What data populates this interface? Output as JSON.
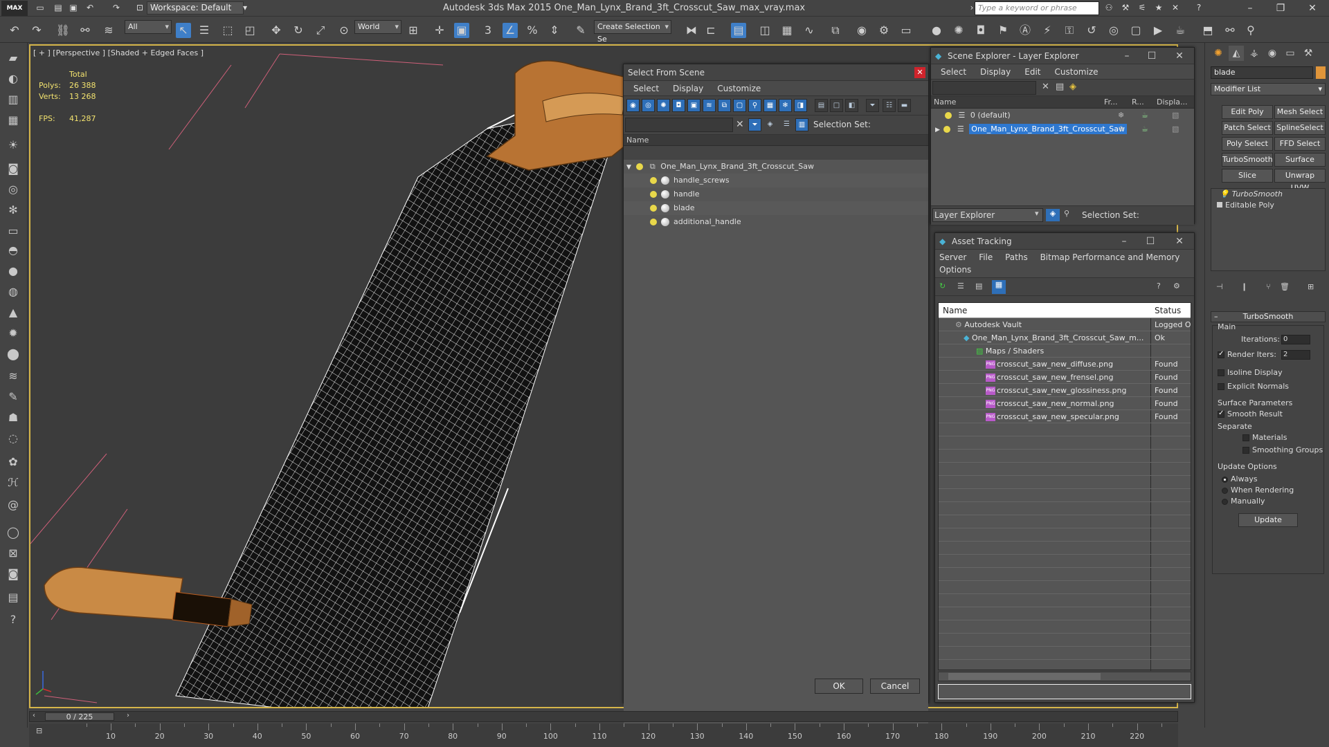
{
  "titlebar": {
    "logo": "MAX",
    "workspace": "Workspace: Default",
    "app_title": "Autodesk 3ds Max  2015      One_Man_Lynx_Brand_3ft_Crosscut_Saw_max_vray.max",
    "search_placeholder": "Type a keyword or phrase"
  },
  "toolbar": {
    "filter_select": "All",
    "coord_select": "World",
    "selection_set_placeholder": "Create Selection Se"
  },
  "viewport": {
    "label": "[ + ] [Perspective ] [Shaded + Edged Faces ]",
    "stats": {
      "header": "Total",
      "polys_label": "Polys:",
      "polys_value": "26 388",
      "verts_label": "Verts:",
      "verts_value": "13 268",
      "fps_label": "FPS:",
      "fps_value": "41,287"
    }
  },
  "select_from_scene": {
    "title": "Select From Scene",
    "menu": [
      "Select",
      "Display",
      "Customize"
    ],
    "selection_set_label": "Selection Set:",
    "column_name": "Name",
    "root": "One_Man_Lynx_Brand_3ft_Crosscut_Saw",
    "children": [
      "handle_screws",
      "handle",
      "blade",
      "additional_handle"
    ],
    "ok_label": "OK",
    "cancel_label": "Cancel"
  },
  "scene_explorer": {
    "title": "Scene Explorer - Layer Explorer",
    "menu": [
      "Select",
      "Display",
      "Edit",
      "Customize"
    ],
    "columns": [
      "Name",
      "Fr...",
      "R...",
      "Displa..."
    ],
    "rows": [
      "0 (default)",
      "One_Man_Lynx_Brand_3ft_Crosscut_Saw"
    ],
    "explorer_select": "Layer Explorer",
    "selection_set_label": "Selection Set:"
  },
  "asset_tracking": {
    "title": "Asset Tracking",
    "menu_row1": [
      "Server",
      "File",
      "Paths",
      "Bitmap Performance and Memory"
    ],
    "menu_row2": [
      "Options"
    ],
    "col_name": "Name",
    "col_status": "Status",
    "rows": [
      {
        "name": "Autodesk Vault",
        "status": "Logged O"
      },
      {
        "name": "One_Man_Lynx_Brand_3ft_Crosscut_Saw_m...",
        "status": "Ok"
      },
      {
        "name": "Maps / Shaders",
        "status": ""
      },
      {
        "name": "crosscut_saw_new_diffuse.png",
        "status": "Found"
      },
      {
        "name": "crosscut_saw_new_frensel.png",
        "status": "Found"
      },
      {
        "name": "crosscut_saw_new_glossiness.png",
        "status": "Found"
      },
      {
        "name": "crosscut_saw_new_normal.png",
        "status": "Found"
      },
      {
        "name": "crosscut_saw_new_specular.png",
        "status": "Found"
      }
    ],
    "png_badge": "PNG"
  },
  "command_panel": {
    "object_name": "blade",
    "modifier_list": "Modifier List",
    "mod_buttons": [
      "Edit Poly",
      "Mesh Select",
      "Patch Select",
      "SplineSelect",
      "Poly Select",
      "FFD Select",
      "TurboSmooth",
      "Surface Select",
      "Slice",
      "Unwrap UVW"
    ],
    "stack": [
      "TurboSmooth",
      "Editable Poly"
    ],
    "rollout_title": "TurboSmooth",
    "main_label": "Main",
    "iterations_label": "Iterations:",
    "iterations_value": "0",
    "render_iters_label": "Render Iters:",
    "render_iters_value": "2",
    "isoline_label": "Isoline Display",
    "explicit_normals_label": "Explicit Normals",
    "surface_params_label": "Surface Parameters",
    "smooth_result_label": "Smooth Result",
    "separate_label": "Separate",
    "materials_label": "Materials",
    "smoothing_groups_label": "Smoothing Groups",
    "update_options_label": "Update Options",
    "always_label": "Always",
    "when_rendering_label": "When Rendering",
    "manually_label": "Manually",
    "update_button": "Update"
  },
  "timeline": {
    "frame_display": "0 / 225",
    "ticks": [
      "10",
      "20",
      "30",
      "40",
      "50",
      "60",
      "70",
      "80",
      "90",
      "100",
      "110",
      "120",
      "130",
      "140",
      "150",
      "160",
      "170",
      "180",
      "190",
      "200",
      "210",
      "220"
    ]
  }
}
